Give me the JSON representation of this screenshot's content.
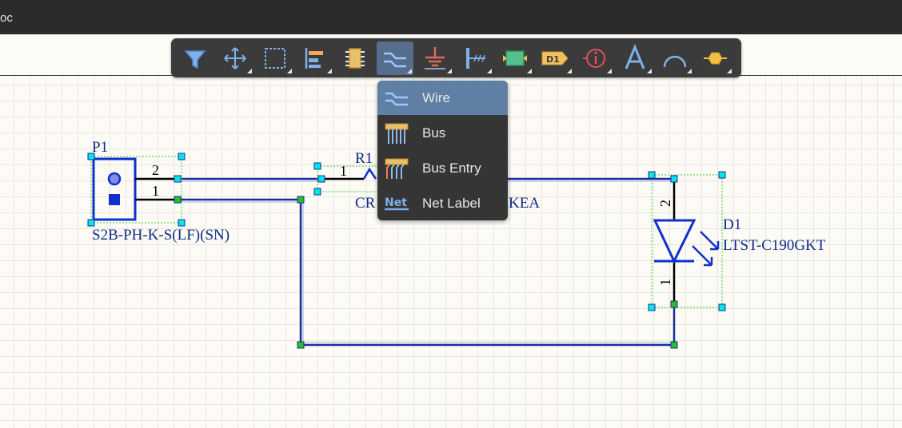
{
  "window": {
    "title": "oc"
  },
  "toolbar": {
    "tools": [
      {
        "name": "filter-tool",
        "icon": "funnel-icon",
        "corner": false
      },
      {
        "name": "move-tool",
        "icon": "move-arrows-icon",
        "corner": true
      },
      {
        "name": "select-tool",
        "icon": "dashed-select-icon",
        "corner": true
      },
      {
        "name": "align-tool",
        "icon": "align-left-icon",
        "corner": true
      },
      {
        "name": "place-part-tool",
        "icon": "component-icon",
        "corner": false
      },
      {
        "name": "wiring-tool",
        "icon": "wire-icon",
        "corner": true,
        "active": true
      },
      {
        "name": "power-port-tool",
        "icon": "ground-icon",
        "corner": true
      },
      {
        "name": "harness-tool",
        "icon": "harness-icon",
        "corner": true
      },
      {
        "name": "sheet-symbol-tool",
        "icon": "sheet-symbol-icon",
        "corner": true
      },
      {
        "name": "port-tool",
        "icon": "port-icon",
        "corner": true
      },
      {
        "name": "directive-tool",
        "icon": "info-icon",
        "corner": true
      },
      {
        "name": "text-tool",
        "icon": "text-a-icon",
        "corner": true
      },
      {
        "name": "arc-tool",
        "icon": "arc-icon",
        "corner": true
      },
      {
        "name": "shape-tool",
        "icon": "hexagon-icon",
        "corner": true
      }
    ],
    "port_badge": "D1"
  },
  "dropdown": {
    "items": [
      {
        "label": "Wire",
        "icon": "wire-icon",
        "selected": true
      },
      {
        "label": "Bus",
        "icon": "bus-icon",
        "selected": false
      },
      {
        "label": "Bus Entry",
        "icon": "bus-entry-icon",
        "selected": false
      },
      {
        "label": "Net Label",
        "icon": "net-label-icon",
        "selected": false
      }
    ],
    "net_badge": "Net"
  },
  "schematic": {
    "colors": {
      "wire": "#1a2e9c",
      "part": "#1030d0",
      "label": "#0c2a8a",
      "handle_cyan": "#00e5e5",
      "handle_green": "#22c322"
    },
    "p1": {
      "designator": "P1",
      "comment": "S2B-PH-K-S(LF)(SN)",
      "pin2": "2",
      "pin1": "1"
    },
    "r1": {
      "designator": "R1",
      "comment_left": "CR",
      "comment_right": "KEA",
      "pin1": "1"
    },
    "d1": {
      "designator": "D1",
      "comment": "LTST-C190GKT",
      "pin2": "2",
      "pin1": "1"
    }
  }
}
